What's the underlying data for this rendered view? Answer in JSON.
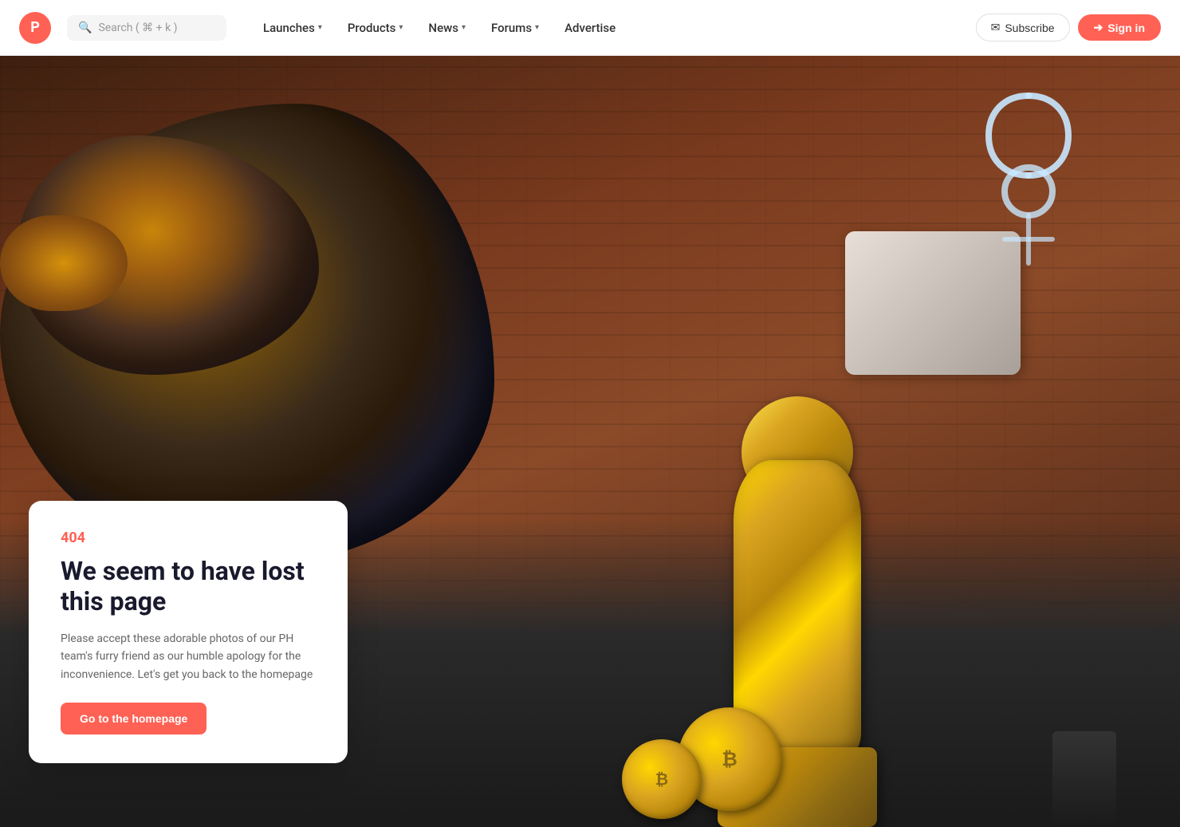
{
  "navbar": {
    "logo_letter": "P",
    "search_placeholder": "Search ( ⌘ + k )",
    "nav_items": [
      {
        "label": "Launches",
        "has_dropdown": true
      },
      {
        "label": "Products",
        "has_dropdown": true
      },
      {
        "label": "News",
        "has_dropdown": true
      },
      {
        "label": "Forums",
        "has_dropdown": true
      },
      {
        "label": "Advertise",
        "has_dropdown": false
      }
    ],
    "subscribe_label": "Subscribe",
    "signin_label": "Sign in"
  },
  "error": {
    "code": "404",
    "title": "We seem to have lost this page",
    "description": "Please accept these adorable photos of our PH team's furry friend as our humble apology for the inconvenience. Let's get you back to the homepage",
    "cta_label": "Go to the homepage"
  },
  "coins": [
    {
      "symbol": "₿"
    },
    {
      "symbol": "₿"
    }
  ]
}
